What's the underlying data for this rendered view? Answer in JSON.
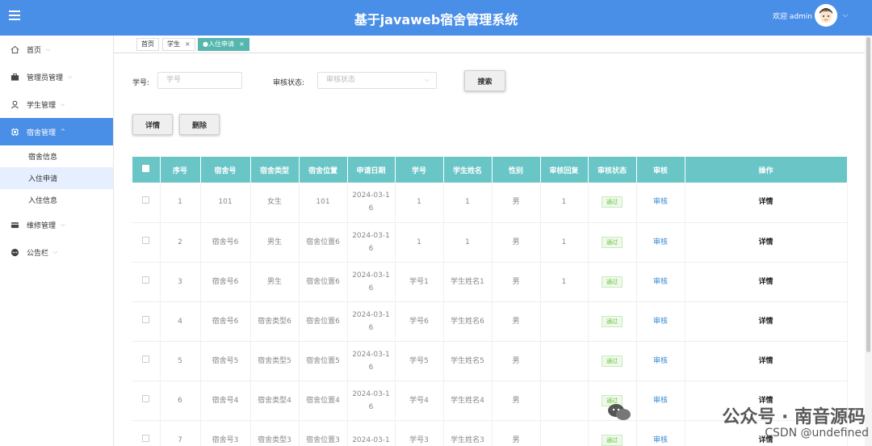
{
  "header": {
    "title": "基于javaweb宿舍管理系统",
    "welcome": "欢迎 admin",
    "bg_color": "#4a8fe7"
  },
  "sidebar": {
    "items": [
      {
        "label": "首页",
        "icon": "home-icon"
      },
      {
        "label": "管理员管理",
        "icon": "briefcase-icon"
      },
      {
        "label": "学生管理",
        "icon": "user-icon"
      },
      {
        "label": "宿舍管理",
        "icon": "chip-icon",
        "active": true
      },
      {
        "label": "维修管理",
        "icon": "wallet-icon"
      },
      {
        "label": "公告栏",
        "icon": "chat-icon"
      }
    ],
    "sub_items": [
      {
        "label": "宿舍信息"
      },
      {
        "label": "入住申请",
        "active": true
      },
      {
        "label": "入住信息"
      }
    ]
  },
  "tabs": [
    {
      "label": "首页"
    },
    {
      "label": "学生"
    },
    {
      "label": "●入住申请",
      "active": true
    }
  ],
  "search": {
    "student_id_label": "学号:",
    "student_id_placeholder": "学号",
    "status_label": "审核状态:",
    "status_placeholder": "审核状态",
    "search_button": "搜索"
  },
  "actions": {
    "detail": "详情",
    "delete": "删除"
  },
  "table": {
    "header_color": "#6ac5c7",
    "columns": [
      "序号",
      "宿舍号",
      "宿舍类型",
      "宿舍位置",
      "申请日期",
      "学号",
      "学生姓名",
      "性别",
      "审核回复",
      "审核状态",
      "审核",
      "操作"
    ],
    "rows": [
      {
        "no": "1",
        "room": "101",
        "type": "女生",
        "location": "101",
        "date_a": "2024-03-1",
        "date_b": "6",
        "sid": "1",
        "name": "1",
        "gender": "男",
        "reply": "1",
        "status": "通过",
        "review": "审核",
        "op": "详情"
      },
      {
        "no": "2",
        "room": "宿舍号6",
        "type": "男生",
        "location": "宿舍位置6",
        "date_a": "2024-03-1",
        "date_b": "6",
        "sid": "1",
        "name": "1",
        "gender": "男",
        "reply": "1",
        "status": "通过",
        "review": "审核",
        "op": "详情"
      },
      {
        "no": "3",
        "room": "宿舍号6",
        "type": "男生",
        "location": "宿舍位置6",
        "date_a": "2024-03-1",
        "date_b": "6",
        "sid": "学号1",
        "name": "学生姓名1",
        "gender": "男",
        "reply": "1",
        "status": "通过",
        "review": "审核",
        "op": "详情"
      },
      {
        "no": "4",
        "room": "宿舍号6",
        "type": "宿舍类型6",
        "location": "宿舍位置6",
        "date_a": "2024-03-1",
        "date_b": "6",
        "sid": "学号6",
        "name": "学生姓名6",
        "gender": "男",
        "reply": "",
        "status": "通过",
        "review": "审核",
        "op": "详情"
      },
      {
        "no": "5",
        "room": "宿舍号5",
        "type": "宿舍类型5",
        "location": "宿舍位置5",
        "date_a": "2024-03-1",
        "date_b": "6",
        "sid": "学号5",
        "name": "学生姓名5",
        "gender": "男",
        "reply": "",
        "status": "通过",
        "review": "审核",
        "op": "详情"
      },
      {
        "no": "6",
        "room": "宿舍号4",
        "type": "宿舍类型4",
        "location": "宿舍位置4",
        "date_a": "2024-03-1",
        "date_b": "6",
        "sid": "学号4",
        "name": "学生姓名4",
        "gender": "男",
        "reply": "",
        "status": "通过",
        "review": "审核",
        "op": "详情"
      },
      {
        "no": "7",
        "room": "宿舍号3",
        "type": "宿舍类型3",
        "location": "宿舍位置3",
        "date_a": "2024-03-1",
        "date_b": "",
        "sid": "学号3",
        "name": "学生姓名3",
        "gender": "男",
        "reply": "",
        "status": "通过",
        "review": "审核",
        "op": "详情"
      }
    ]
  },
  "watermark": {
    "line1": "公众号 · 南音源码",
    "line2": "CSDN @undefined"
  }
}
